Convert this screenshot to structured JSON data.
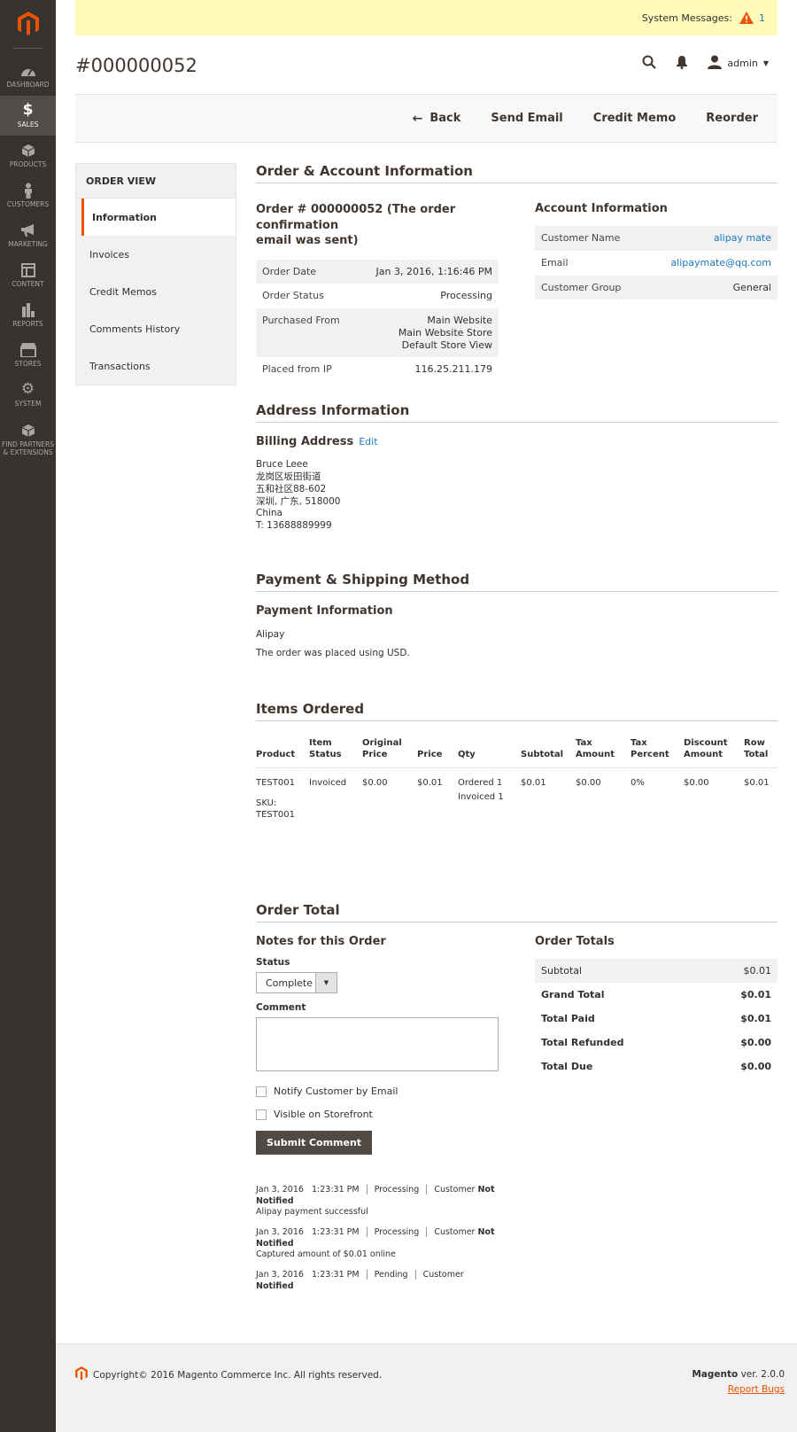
{
  "nav": {
    "items": [
      {
        "label": "DASHBOARD",
        "icon": "dashboard-icon"
      },
      {
        "label": "SALES",
        "icon": "dollar-icon"
      },
      {
        "label": "PRODUCTS",
        "icon": "box-icon"
      },
      {
        "label": "CUSTOMERS",
        "icon": "person-icon"
      },
      {
        "label": "MARKETING",
        "icon": "megaphone-icon"
      },
      {
        "label": "CONTENT",
        "icon": "layout-icon"
      },
      {
        "label": "REPORTS",
        "icon": "bar-chart-icon"
      },
      {
        "label": "STORES",
        "icon": "storefront-icon"
      },
      {
        "label": "SYSTEM",
        "icon": "gear-icon"
      },
      {
        "label_line1": "FIND PARTNERS",
        "label_line2": "& EXTENSIONS",
        "icon": "partners-icon"
      }
    ]
  },
  "system_messages": {
    "label": "System Messages:",
    "count": "1"
  },
  "header": {
    "title": "#000000052",
    "user": "admin"
  },
  "actions": {
    "back": "Back",
    "send_email": "Send Email",
    "credit_memo": "Credit Memo",
    "reorder": "Reorder"
  },
  "tabs": {
    "title": "ORDER VIEW",
    "items": [
      "Information",
      "Invoices",
      "Credit Memos",
      "Comments History",
      "Transactions"
    ]
  },
  "order_account": {
    "section_title": "Order & Account Information",
    "order_heading_line1": "Order # 000000052 (The order confirmation",
    "order_heading_line2": "email was sent)",
    "order_rows": [
      {
        "k": "Order Date",
        "v": "Jan 3, 2016, 1:16:46 PM"
      },
      {
        "k": "Order Status",
        "v": "Processing"
      },
      {
        "k": "Purchased From",
        "v1": "Main Website",
        "v2": "Main Website Store",
        "v3": "Default Store View"
      },
      {
        "k": "Placed from IP",
        "v": "116.25.211.179"
      }
    ],
    "account_heading": "Account Information",
    "account_rows": [
      {
        "k": "Customer Name",
        "v": "alipay mate"
      },
      {
        "k": "Email",
        "v": "alipaymate@qq.com"
      },
      {
        "k": "Customer Group",
        "v": "General"
      }
    ]
  },
  "address": {
    "section_title": "Address Information",
    "billing_heading": "Billing Address",
    "edit_link": "Edit",
    "lines": [
      "Bruce Leee",
      "龙岗区坂田街道",
      "五和社区88-602",
      "深圳, 广东, 518000",
      "China",
      "T: 13688889999"
    ]
  },
  "payment": {
    "section_title": "Payment & Shipping Method",
    "heading": "Payment Information",
    "method": "Alipay",
    "currency_note": "The order was placed using USD."
  },
  "items": {
    "section_title": "Items Ordered",
    "headers": [
      {
        "l1": "",
        "l2": "Product"
      },
      {
        "l1": "Item",
        "l2": "Status"
      },
      {
        "l1": "Original",
        "l2": "Price"
      },
      {
        "l1": "",
        "l2": "Price"
      },
      {
        "l1": "",
        "l2": "Qty"
      },
      {
        "l1": "",
        "l2": "Subtotal"
      },
      {
        "l1": "Tax",
        "l2": "Amount"
      },
      {
        "l1": "Tax",
        "l2": "Percent"
      },
      {
        "l1": "Discount",
        "l2": "Amount"
      },
      {
        "l1": "Row",
        "l2": "Total"
      }
    ],
    "row": {
      "product": "TEST001",
      "sku_label": "SKU:",
      "sku": "TEST001",
      "status": "Invoiced",
      "original_price": "$0.00",
      "price": "$0.01",
      "qty_ordered": "Ordered 1",
      "qty_invoiced": "Invoiced 1",
      "subtotal": "$0.01",
      "tax_amount": "$0.00",
      "tax_percent": "0%",
      "discount": "$0.00",
      "row_total": "$0.01"
    }
  },
  "order_total": {
    "section_title": "Order Total",
    "notes_heading": "Notes for this Order",
    "status_label": "Status",
    "status_value": "Complete",
    "comment_label": "Comment",
    "notify_label": "Notify Customer by Email",
    "visible_label": "Visible on Storefront",
    "submit_label": "Submit Comment",
    "history": [
      {
        "date": "Jan 3, 2016",
        "time": "1:23:31 PM",
        "status": "Processing",
        "customer": "Customer",
        "notified": "Not",
        "notified2": "Notified",
        "comment": "Alipay payment successful"
      },
      {
        "date": "Jan 3, 2016",
        "time": "1:23:31 PM",
        "status": "Processing",
        "customer": "Customer",
        "notified": "Not",
        "notified2": "Notified",
        "comment": "Captured amount of $0.01 online"
      },
      {
        "date": "Jan 3, 2016",
        "time": "1:23:31 PM",
        "status": "Pending",
        "customer": "Customer",
        "notified": "Notified"
      }
    ],
    "totals_heading": "Order Totals",
    "totals": [
      {
        "k": "Subtotal",
        "v": "$0.01"
      },
      {
        "k": "Grand Total",
        "v": "$0.01"
      },
      {
        "k": "Total Paid",
        "v": "$0.01"
      },
      {
        "k": "Total Refunded",
        "v": "$0.00"
      },
      {
        "k": "Total Due",
        "v": "$0.00"
      }
    ]
  },
  "footer": {
    "copyright": "Copyright© 2016 Magento Commerce Inc. All rights reserved.",
    "brand": "Magento",
    "version": "ver. 2.0.0",
    "report_bugs": "Report Bugs"
  },
  "colors": {
    "accent": "#eb5202",
    "sidebar": "#373330",
    "link": "#1979c3",
    "notice": "#fffbbb"
  }
}
